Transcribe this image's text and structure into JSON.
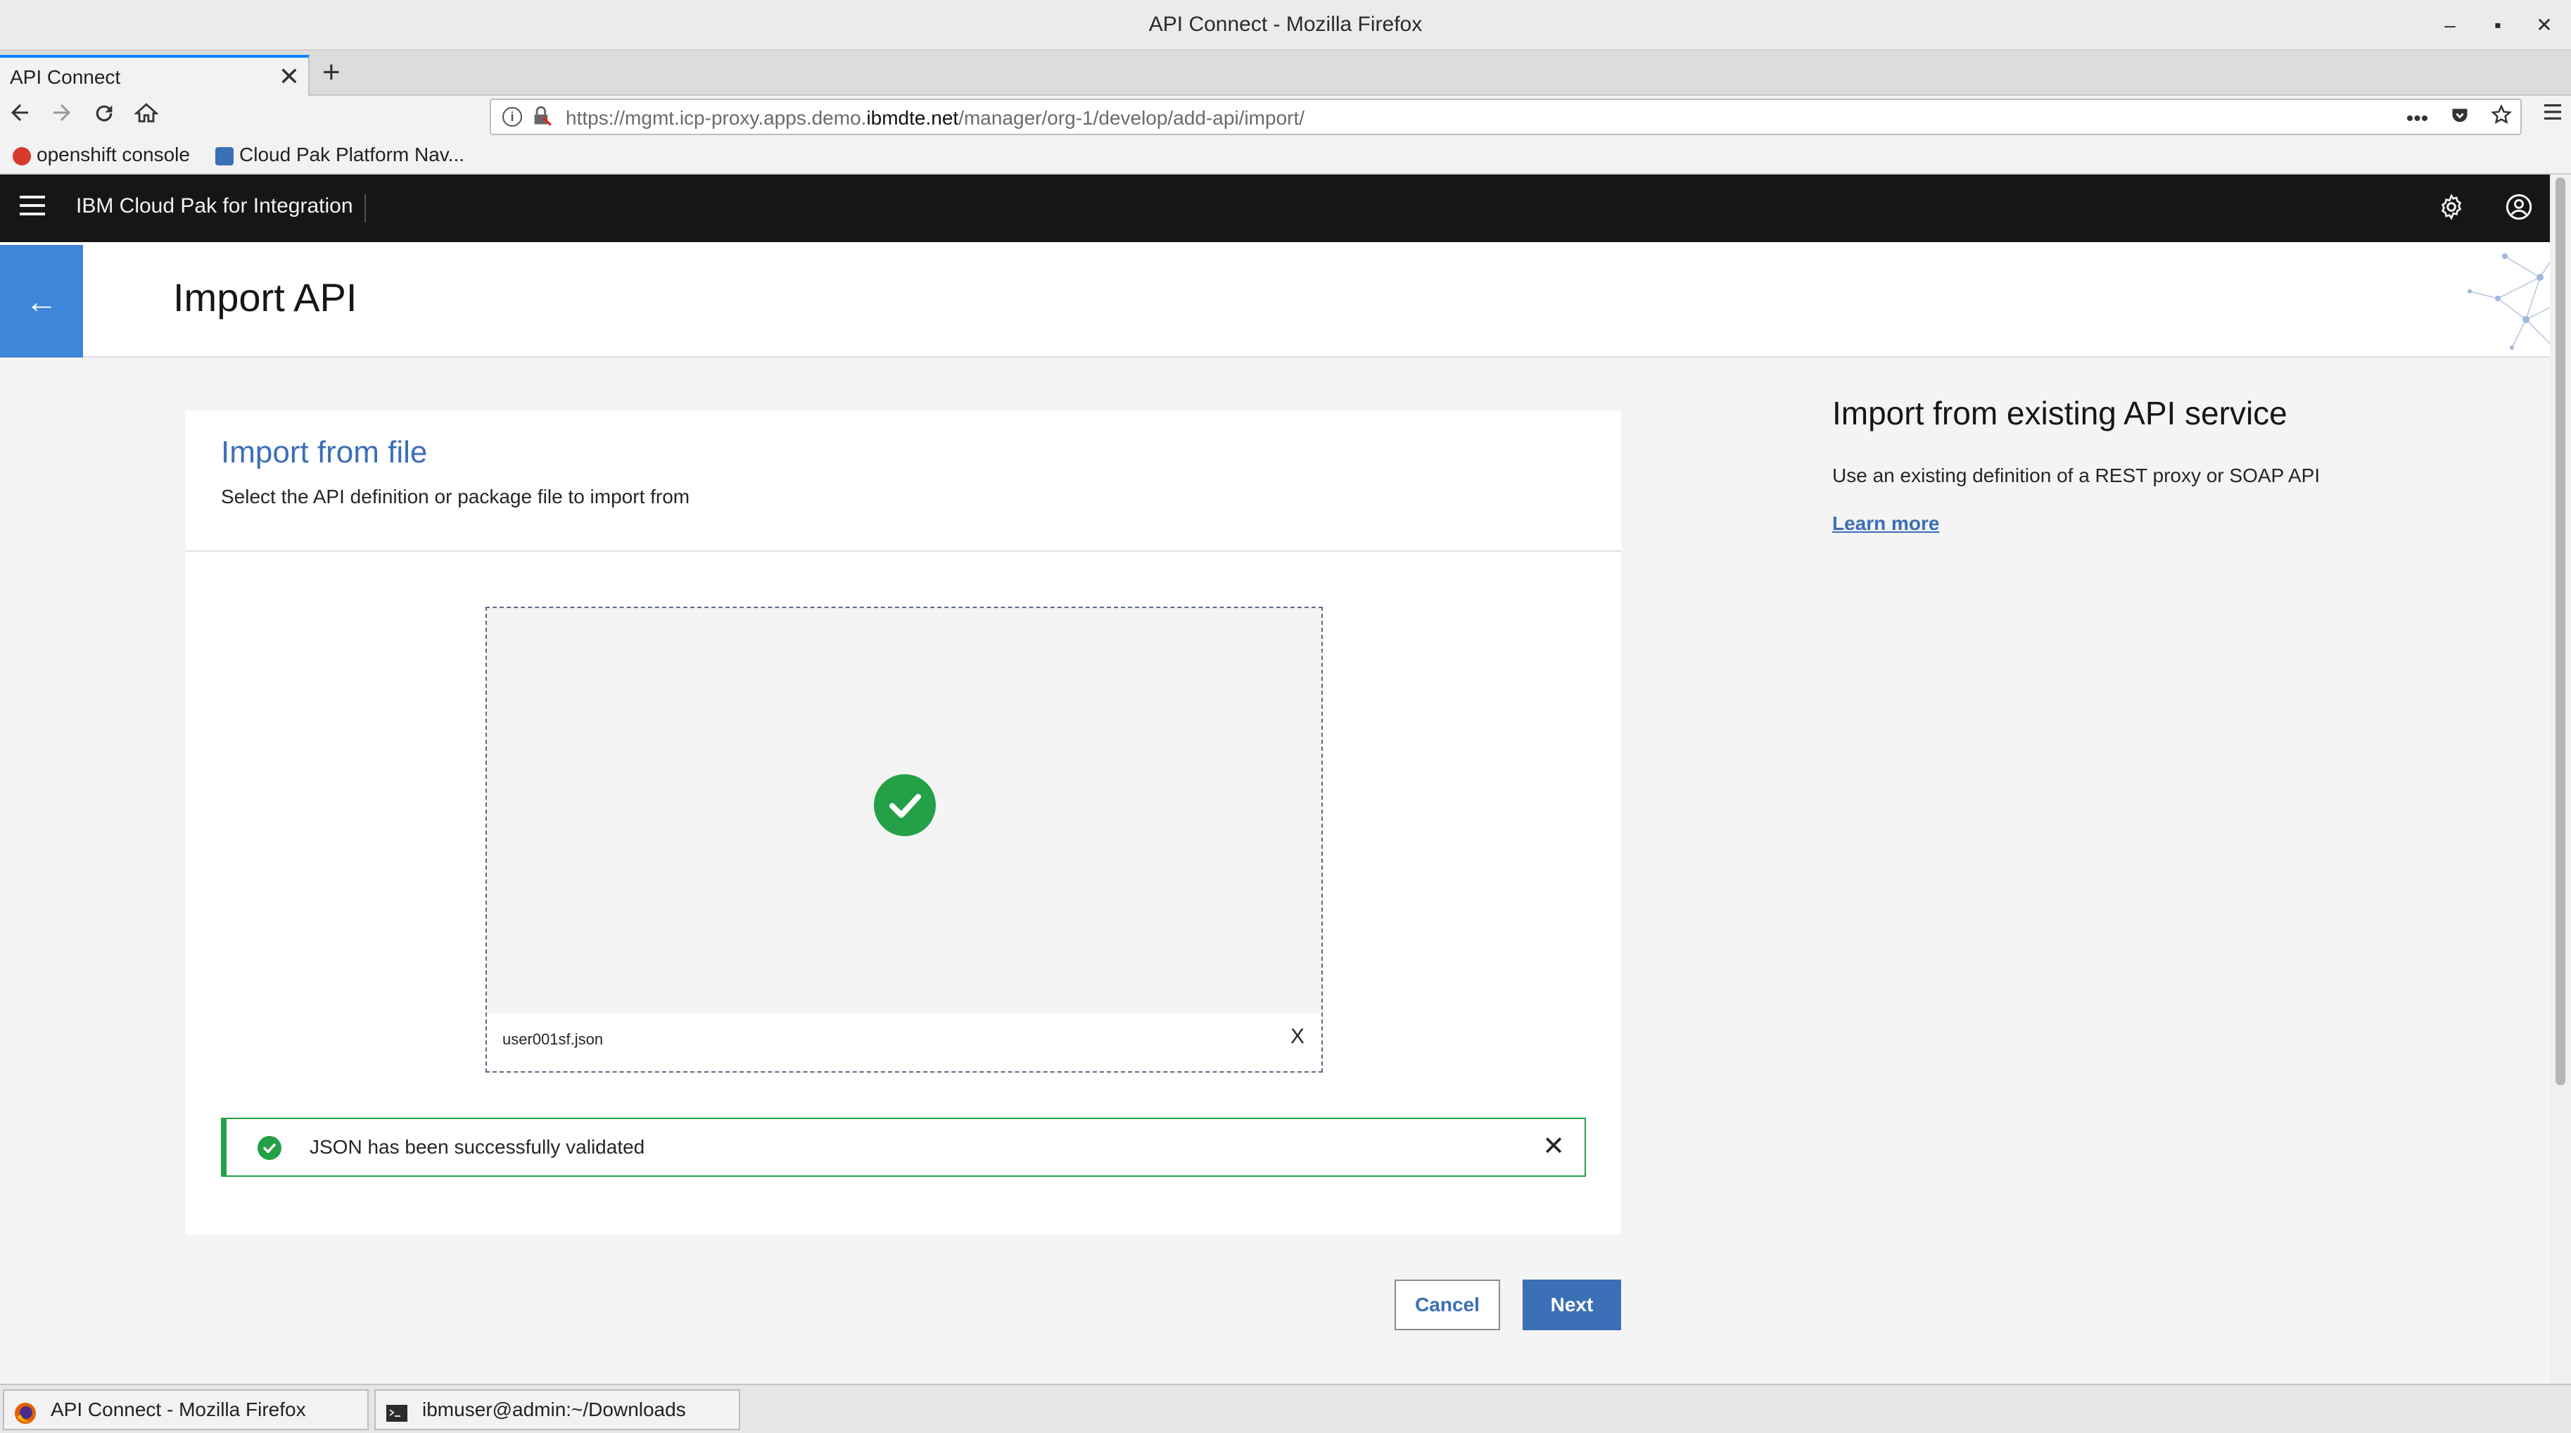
{
  "window": {
    "title": "API Connect - Mozilla Firefox",
    "minimize": "–",
    "maximize": "▪",
    "close": "✕"
  },
  "browser": {
    "tab_title": "API Connect",
    "tab_close": "✕",
    "new_tab": "+",
    "url_prefix": "https://mgmt.icp-proxy.apps.demo.",
    "url_host": "ibmdte.net",
    "url_path": "/manager/org-1/develop/add-api/import/",
    "url_actions": "•••",
    "bookmarks": [
      {
        "label": "openshift console",
        "icon_color": "#d73a2b"
      },
      {
        "label": "Cloud Pak Platform Nav...",
        "icon_color": "#3b6fb6"
      }
    ]
  },
  "app": {
    "name": "IBM Cloud Pak for Integration"
  },
  "page": {
    "title": "Import API",
    "back_label": "←"
  },
  "import_card": {
    "title": "Import from file",
    "subtitle": "Select the API definition or package file to import from",
    "file_name": "user001sf.json",
    "remove_label": "X",
    "notification": "JSON has been successfully validated",
    "notification_close": "✕"
  },
  "side_panel": {
    "title": "Import from existing API service",
    "description": "Use an existing definition of a REST proxy or SOAP API",
    "link": "Learn more"
  },
  "actions": {
    "cancel": "Cancel",
    "next": "Next"
  },
  "taskbar": {
    "items": [
      {
        "label": "API Connect - Mozilla Firefox"
      },
      {
        "label": "ibmuser@admin:~/Downloads"
      }
    ]
  },
  "colors": {
    "accent": "#3b6fb6",
    "success": "#24a148",
    "header_bg": "#161616",
    "back_button": "#3d86d8"
  }
}
